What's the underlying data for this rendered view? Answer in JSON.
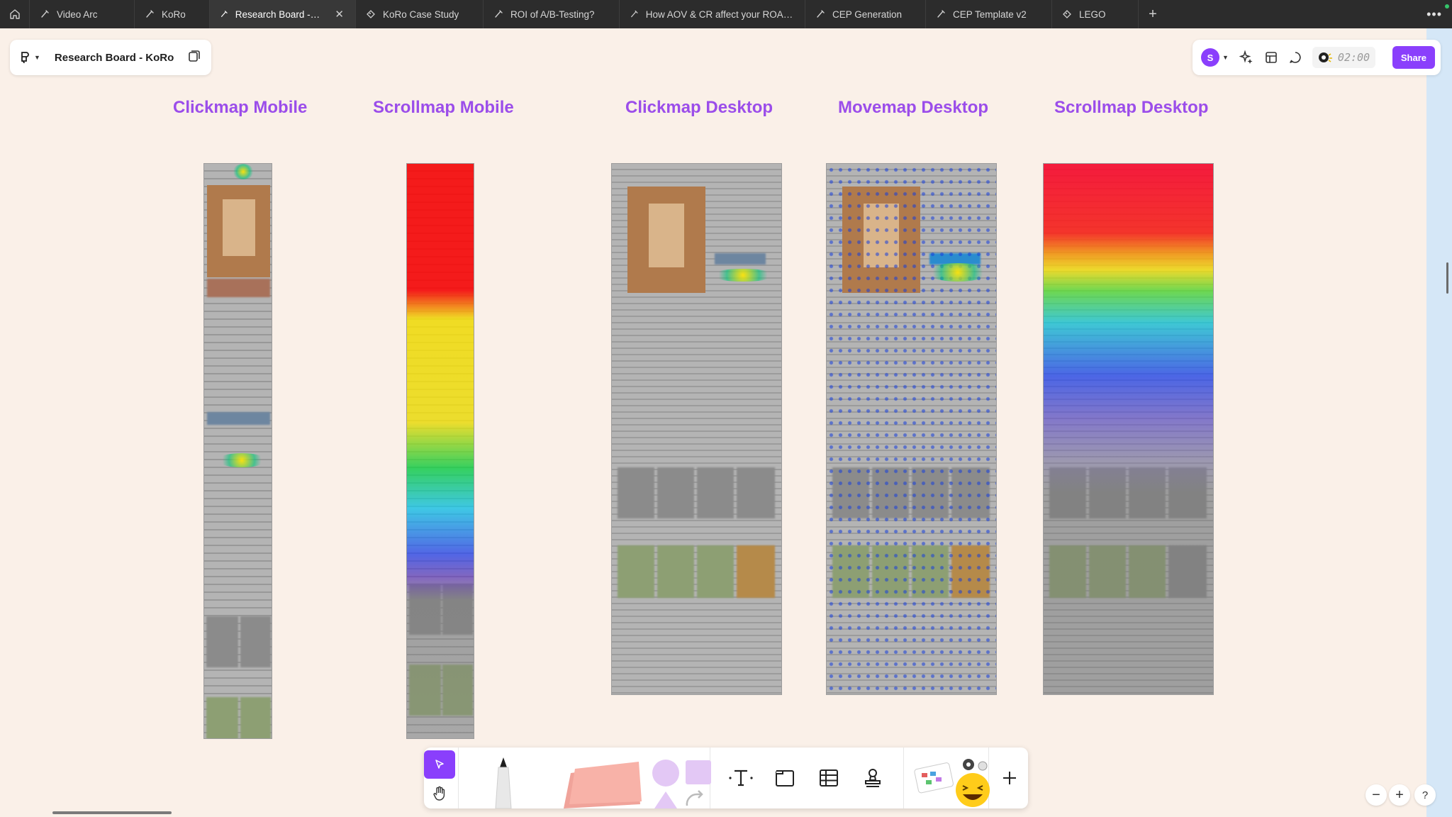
{
  "tabs": [
    {
      "label": "Video Arc",
      "active": false
    },
    {
      "label": "KoRo",
      "active": false
    },
    {
      "label": "Research Board - KoRo",
      "active": true
    },
    {
      "label": "KoRo Case Study",
      "active": false
    },
    {
      "label": "ROI of A/B-Testing?",
      "active": false
    },
    {
      "label": "How AOV & CR affect your ROAS and",
      "active": false
    },
    {
      "label": "CEP Generation",
      "active": false
    },
    {
      "label": "CEP Template v2",
      "active": false
    },
    {
      "label": "LEGO",
      "active": false
    }
  ],
  "file": {
    "title": "Research Board - KoRo"
  },
  "header": {
    "avatar_initial": "S",
    "timer": "02:00",
    "share_label": "Share"
  },
  "columns": [
    {
      "title": "Clickmap Mobile"
    },
    {
      "title": "Scrollmap Mobile"
    },
    {
      "title": "Clickmap Desktop"
    },
    {
      "title": "Movemap Desktop"
    },
    {
      "title": "Scrollmap Desktop"
    }
  ],
  "colors": {
    "accent": "#8a3ffc",
    "title": "#9b4dea",
    "canvas": "#faf0e8",
    "tabbar": "#2c2c2c"
  },
  "icons": {
    "home": "home-icon",
    "figjam": "figjam-logo-icon",
    "select": "cursor-icon",
    "hand": "hand-icon",
    "text": "text-icon",
    "section": "section-icon",
    "table": "table-icon",
    "stamp": "stamp-icon",
    "add": "plus-icon"
  }
}
